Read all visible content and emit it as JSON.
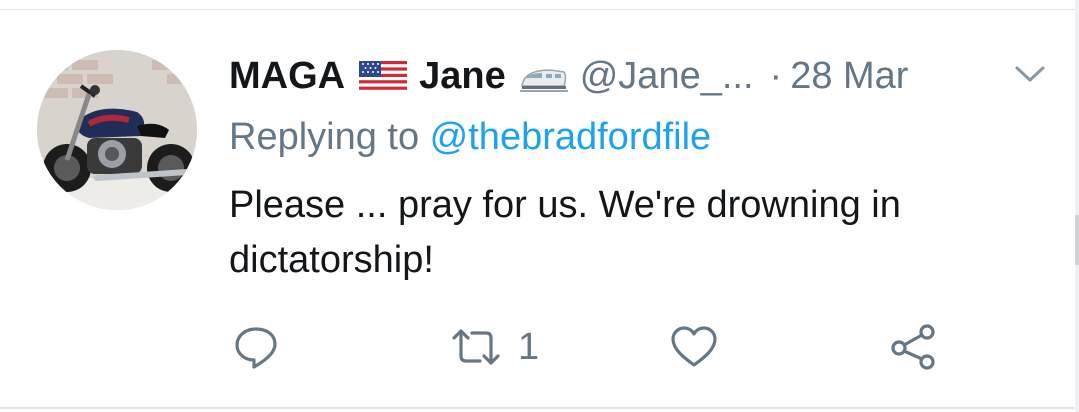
{
  "tweet": {
    "display_name_left": "MAGA",
    "display_name_right": "Jane",
    "name_emojis": [
      "us-flag-icon",
      "high-speed-train-icon"
    ],
    "handle": "@Jane_...",
    "separator": "·",
    "time": "28 Mar",
    "replying_prefix": "Replying to ",
    "replying_handle": "@thebradfordfile",
    "text": "Please ... pray for us. We're drowning in dictatorship!"
  },
  "actions": {
    "reply_icon": "reply-icon",
    "retweet_icon": "retweet-icon",
    "retweet_count": "1",
    "like_icon": "heart-icon",
    "share_icon": "share-icon",
    "menu_icon": "chevron-down-icon"
  },
  "colors": {
    "name": "#14171a",
    "secondary": "#657786",
    "link": "#1da1f2",
    "divider": "#dfe4e8"
  }
}
